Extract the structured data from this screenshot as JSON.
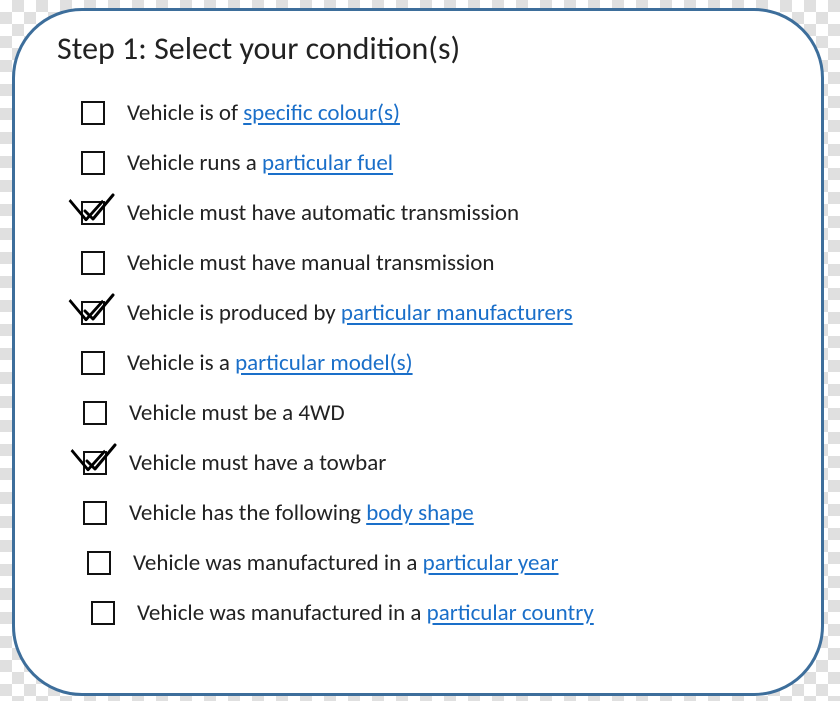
{
  "title": "Step 1: Select your condition(s)",
  "items": [
    {
      "checked": false,
      "pre": "Vehicle is of ",
      "link": "specific colour(s)",
      "post": "",
      "nudge": 0
    },
    {
      "checked": false,
      "pre": "Vehicle runs a ",
      "link": "particular fuel",
      "post": "",
      "nudge": 0
    },
    {
      "checked": true,
      "pre": "Vehicle must have automatic transmission",
      "link": "",
      "post": "",
      "nudge": 0
    },
    {
      "checked": false,
      "pre": "Vehicle must have manual transmission",
      "link": "",
      "post": "",
      "nudge": 0
    },
    {
      "checked": true,
      "pre": "Vehicle is produced by ",
      "link": "particular manufacturers",
      "post": "",
      "nudge": 0
    },
    {
      "checked": false,
      "pre": "Vehicle is a ",
      "link": "particular model(s)",
      "post": "",
      "nudge": 0
    },
    {
      "checked": false,
      "pre": "Vehicle must be a 4WD",
      "link": "",
      "post": "",
      "nudge": 1
    },
    {
      "checked": true,
      "pre": "Vehicle must have a towbar",
      "link": "",
      "post": "",
      "nudge": 1
    },
    {
      "checked": false,
      "pre": "Vehicle has the following ",
      "link": "body shape",
      "post": "",
      "nudge": 1
    },
    {
      "checked": false,
      "pre": "Vehicle was manufactured in a ",
      "link": "particular year",
      "post": "",
      "nudge": 2
    },
    {
      "checked": false,
      "pre": "Vehicle was manufactured in a ",
      "link": "particular country",
      "post": "",
      "nudge": 3
    }
  ]
}
